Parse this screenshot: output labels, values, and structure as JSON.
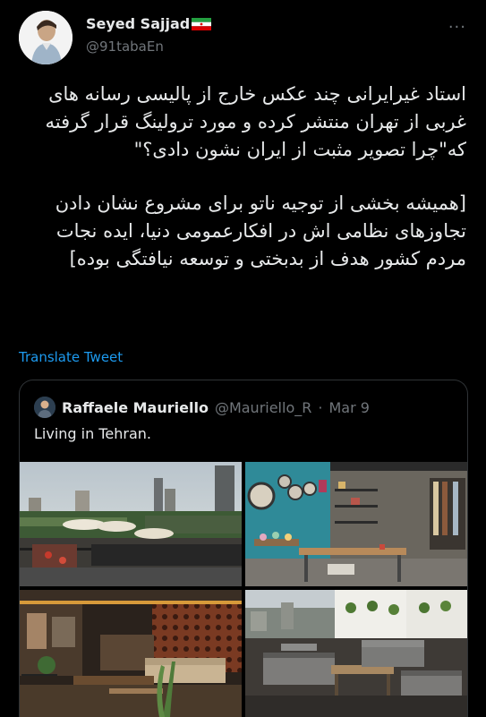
{
  "tweet": {
    "author_name": "Seyed Sajjad",
    "author_handle": "@91tabaEn",
    "more_label": "···",
    "paragraphs": [
      "استاد غیرایرانی چند عکس خارج از پالیسی رسانه های غربی از تهران منتشر کرده و مورد ترولینگ قرار گرفته که\"چرا تصویر مثبت از ایران نشون دادی؟\"",
      "[همیشه بخشی از توجیه ناتو برای مشروع نشان دادن تجاوزهای نظامی اش در افکارعمومی دنیا، ایده نجات مردم کشور هدف از بدبختی و توسعه نیافتگی بوده]"
    ],
    "translate_label": "Translate Tweet"
  },
  "quote": {
    "author_name": "Raffaele Mauriello",
    "author_handle": "@Mauriello_R",
    "separator": "·",
    "date": "Mar 9",
    "text": "Living in Tehran."
  },
  "colors": {
    "background": "#000000",
    "text": "#e7e9ea",
    "muted": "#71767b",
    "link": "#1d9bf0",
    "border": "#2f3336"
  }
}
